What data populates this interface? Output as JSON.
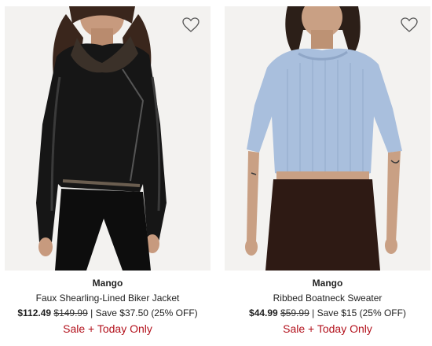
{
  "products": [
    {
      "brand": "Mango",
      "name": "Faux Shearling-Lined Biker Jacket",
      "sale_price": "$112.49",
      "original_price": "$149.99",
      "savings": "| Save $37.50 (25% OFF)",
      "promo": "Sale + Today Only",
      "wishlist_icon": "heart-outline-icon"
    },
    {
      "brand": "Mango",
      "name": "Ribbed Boatneck Sweater",
      "sale_price": "$44.99",
      "original_price": "$59.99",
      "savings": "| Save $15 (25% OFF)",
      "promo": "Sale + Today Only",
      "wishlist_icon": "heart-outline-icon"
    }
  ],
  "colors": {
    "promo_red": "#b3121d",
    "text": "#1f1f1f",
    "image_bg": "#f3f2f0"
  }
}
